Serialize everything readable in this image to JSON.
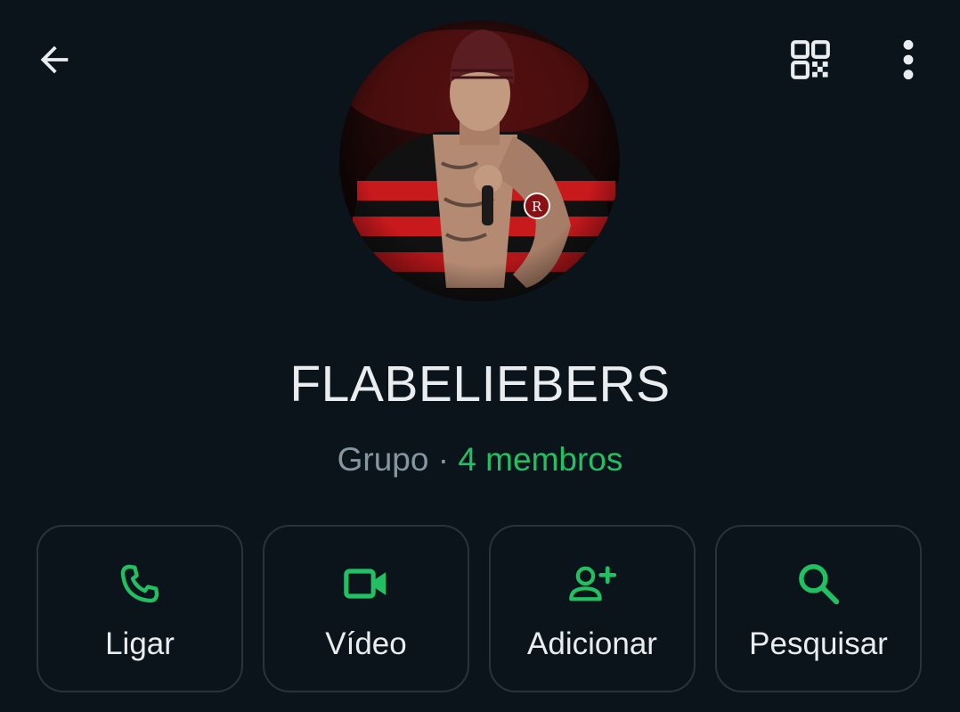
{
  "colors": {
    "background": "#0b141a",
    "accent_green": "#21c063",
    "primary_text": "#e9edef",
    "secondary_text": "#8696a0",
    "button_border": "#2a3339"
  },
  "topbar": {
    "back_icon": "arrow-left-icon",
    "qr_icon": "qr-code-icon",
    "menu_icon": "more-vertical-icon"
  },
  "profile": {
    "avatar_alt": "avatar-photo",
    "name": "FLABELIEBERS",
    "type_label": "Grupo",
    "separator": " · ",
    "members_label": "4 membros"
  },
  "actions": [
    {
      "label": "Ligar",
      "icon": "phone-icon"
    },
    {
      "label": "Vídeo",
      "icon": "video-camera-icon"
    },
    {
      "label": "Adicionar",
      "icon": "add-person-icon"
    },
    {
      "label": "Pesquisar",
      "icon": "search-icon"
    }
  ]
}
